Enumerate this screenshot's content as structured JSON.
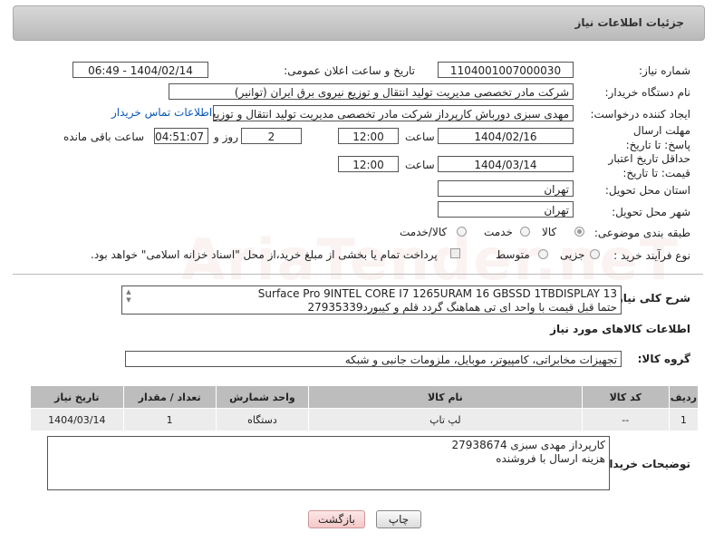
{
  "header": {
    "title": "جزئیات اطلاعات نیاز"
  },
  "fields": {
    "need_number_label": "شماره نیاز:",
    "need_number": "1104001007000030",
    "announce_label": "تاریخ و ساعت اعلان عمومی:",
    "announce_value": "1404/02/14 - 06:49",
    "buyer_org_label": "نام دستگاه خریدار:",
    "buyer_org": "شرکت مادر تخصصی مدیریت تولید  انتقال و توزیع نیروی برق ایران (توانیر)",
    "creator_label": "ایجاد کننده درخواست:",
    "creator": "مهدی سبزی دورباش کارپرداز شرکت مادر تخصصی مدیریت تولید  انتقال و توزیع ن",
    "contact_link": "اطلاعات تماس خریدار",
    "deadline_label": "مهلت ارسال پاسخ: تا تاریخ:",
    "deadline_date": "1404/02/16",
    "time_label": "ساعت",
    "deadline_time": "12:00",
    "days_value": "2",
    "days_label": "روز و",
    "remaining_time": "04:51:07",
    "remaining_label": "ساعت باقی مانده",
    "validity_label": "حداقل تاریخ اعتبار قیمت: تا تاریخ:",
    "validity_date": "1404/03/14",
    "validity_time": "12:00",
    "province_label": "استان محل تحویل:",
    "province": "تهران",
    "city_label": "شهر محل تحویل:",
    "city": "تهران",
    "category_label": "طبقه بندی موضوعی:",
    "category_options": [
      "کالا",
      "خدمت",
      "کالا/خدمت"
    ],
    "process_label": "نوع فرآیند خرید :",
    "process_options": [
      "جزیی",
      "متوسط"
    ],
    "payment_note": "پرداخت تمام یا بخشی از مبلغ خرید،از محل \"اسناد خزانه اسلامی\" خواهد بود."
  },
  "description": {
    "label": "شرح کلی نیاز:",
    "line1": "Surface Pro 9INTEL CORE I7 1265URAM 16 GBSSD 1TBDISPLAY 13",
    "line2": "حتما قبل قیمت با واحد ای تی هماهنگ گردد قلم و کیبورد27935339"
  },
  "goods": {
    "section_title": "اطلاعات کالاهای مورد نیاز",
    "group_label": "گروه کالا:",
    "group_value": "تجهیزات مخابراتی، کامپیوتر، موبایل، ملزومات جانبی و شبکه",
    "columns": [
      "ردیف",
      "کد کالا",
      "نام کالا",
      "واحد شمارش",
      "تعداد / مقدار",
      "تاریخ نیاز"
    ],
    "rows": [
      {
        "row": "1",
        "code": "--",
        "name": "لپ تاپ",
        "unit": "دستگاه",
        "qty": "1",
        "date": "1404/03/14"
      }
    ]
  },
  "buyer_notes": {
    "label": "توضیحات خریدار:",
    "line1": "کارپرداز مهدی سبزی 27938674",
    "line2": "هزینه ارسال با فروشنده"
  },
  "buttons": {
    "print": "چاپ",
    "back": "بازگشت"
  },
  "watermark": "AriaTender.neT"
}
